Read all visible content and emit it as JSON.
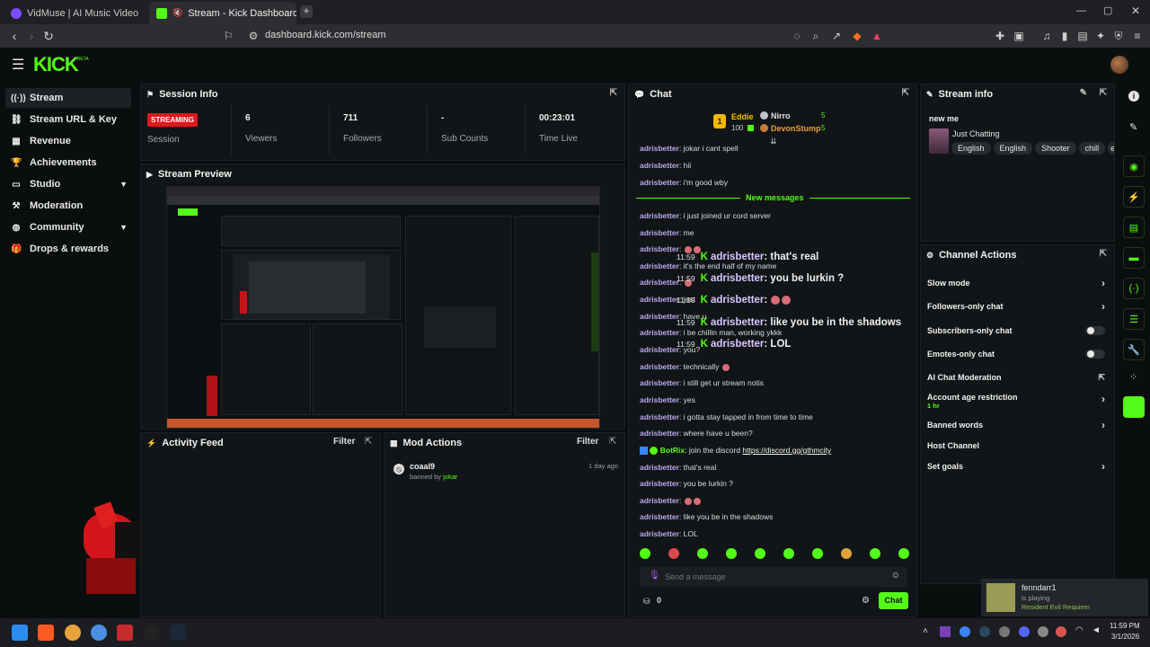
{
  "browser": {
    "tabs": [
      {
        "title": "VidMuse | AI Music Video Agent for Cr",
        "active": false
      },
      {
        "title": "Stream - Kick Dashboard",
        "active": true
      }
    ],
    "url": "dashboard.kick.com/stream"
  },
  "brand": {
    "logo": "KICK",
    "beta": "BETA",
    "accent": "#53fc18"
  },
  "sidebar": {
    "items": [
      {
        "label": "Stream",
        "icon": "broadcast-icon",
        "active": true
      },
      {
        "label": "Stream URL & Key",
        "icon": "link-icon"
      },
      {
        "label": "Revenue",
        "icon": "chart-icon"
      },
      {
        "label": "Achievements",
        "icon": "trophy-icon"
      },
      {
        "label": "Studio",
        "icon": "monitor-icon",
        "expandable": true
      },
      {
        "label": "Moderation",
        "icon": "gavel-icon"
      },
      {
        "label": "Community",
        "icon": "globe-icon",
        "expandable": true
      },
      {
        "label": "Drops & rewards",
        "icon": "gift-icon"
      }
    ]
  },
  "session": {
    "title": "Session Info",
    "status": "STREAMING",
    "status_label": "Session",
    "stats": [
      {
        "value": "6",
        "label": "Viewers"
      },
      {
        "value": "711",
        "label": "Followers"
      },
      {
        "value": "-",
        "label": "Sub Counts"
      },
      {
        "value": "00:23:01",
        "label": "Time Live"
      }
    ]
  },
  "preview": {
    "title": "Stream Preview"
  },
  "activity": {
    "title": "Activity Feed",
    "filter": "Filter"
  },
  "mod_actions": {
    "title": "Mod Actions",
    "filter": "Filter",
    "items": [
      {
        "user": "coaal9",
        "action": "banned by",
        "by": "jokar",
        "time": "1 day ago"
      }
    ]
  },
  "chat": {
    "title": "Chat",
    "leaderboard": [
      {
        "rank": "1",
        "name": "Eddie",
        "points": "100"
      },
      {
        "name": "Nirro",
        "points": "5"
      },
      {
        "name": "DevonStump",
        "points": "5"
      }
    ],
    "new_messages": "New messages",
    "messages": [
      {
        "user": "adrisbetter",
        "text": "jokar i cant spell"
      },
      {
        "user": "adrisbetter",
        "text": "hii"
      },
      {
        "user": "adrisbetter",
        "text": "i'm good wby"
      },
      {
        "user": "adrisbetter",
        "text": "i just joined ur cord server"
      },
      {
        "user": "adrisbetter",
        "text": "me"
      },
      {
        "user": "adrisbetter",
        "text": ""
      },
      {
        "user": "adrisbetter",
        "text": "it's the end half of my name"
      },
      {
        "user": "adrisbetter",
        "text": ""
      },
      {
        "user": "adrisbetter",
        "text": "just"
      },
      {
        "user": "adrisbetter",
        "text": "have u"
      },
      {
        "user": "adrisbetter",
        "text": "i be chillin man, working ykkk"
      },
      {
        "user": "adrisbetter",
        "text": "you?"
      },
      {
        "user": "adrisbetter",
        "text": "technically"
      },
      {
        "user": "adrisbetter",
        "text": "i still get ur stream notis"
      },
      {
        "user": "adrisbetter",
        "text": "yes"
      },
      {
        "user": "adrisbetter",
        "text": "i gotta stay tapped in from time to time"
      },
      {
        "user": "adrisbetter",
        "text": "where have u been?"
      },
      {
        "user": "BotRix",
        "text": "join the discord",
        "link": "https://discord.gg/gthmcity"
      },
      {
        "user": "adrisbetter",
        "text": "that's real"
      },
      {
        "user": "adrisbetter",
        "text": "you be lurkin ?"
      },
      {
        "user": "adrisbetter",
        "text": ""
      },
      {
        "user": "adrisbetter",
        "text": "like you be in the shadows"
      },
      {
        "user": "adrisbetter",
        "text": "LOL"
      }
    ],
    "overlay": [
      {
        "time": "11:59",
        "user": "adrisbetter",
        "text": "that's real"
      },
      {
        "time": "11:59",
        "user": "adrisbetter",
        "text": "you be lurkin ?"
      },
      {
        "time": "11:59",
        "user": "adrisbetter",
        "text": ""
      },
      {
        "time": "11:59",
        "user": "adrisbetter",
        "text": "like you be in the shadows"
      },
      {
        "time": "11:59",
        "user": "adrisbetter",
        "text": "LOL"
      }
    ],
    "input_placeholder": "Send a message",
    "points": "0",
    "send": "Chat"
  },
  "stream_info": {
    "title": "Stream info",
    "stream_title": "new me",
    "category": "Just Chatting",
    "tags": [
      "English",
      "English",
      "Shooter",
      "chill"
    ]
  },
  "channel_actions": {
    "title": "Channel Actions",
    "items": [
      {
        "label": "Slow mode",
        "type": "arrow"
      },
      {
        "label": "Followers-only chat",
        "type": "arrow"
      },
      {
        "label": "Subscribers-only chat",
        "type": "toggle"
      },
      {
        "label": "Emotes-only chat",
        "type": "toggle"
      },
      {
        "label": "AI Chat Moderation",
        "type": "external"
      },
      {
        "label": "Account age restriction",
        "sub": "1 hr",
        "type": "arrow"
      },
      {
        "label": "Banned words",
        "type": "arrow"
      },
      {
        "label": "Host Channel",
        "type": "none"
      },
      {
        "label": "Set goals",
        "type": "arrow"
      }
    ]
  },
  "steam_toast": {
    "name": "fenndarr1",
    "status": "is playing",
    "game": "Resident Evil Requiem"
  },
  "taskbar": {
    "time": "11:59 PM",
    "date": "3/1/2026"
  }
}
